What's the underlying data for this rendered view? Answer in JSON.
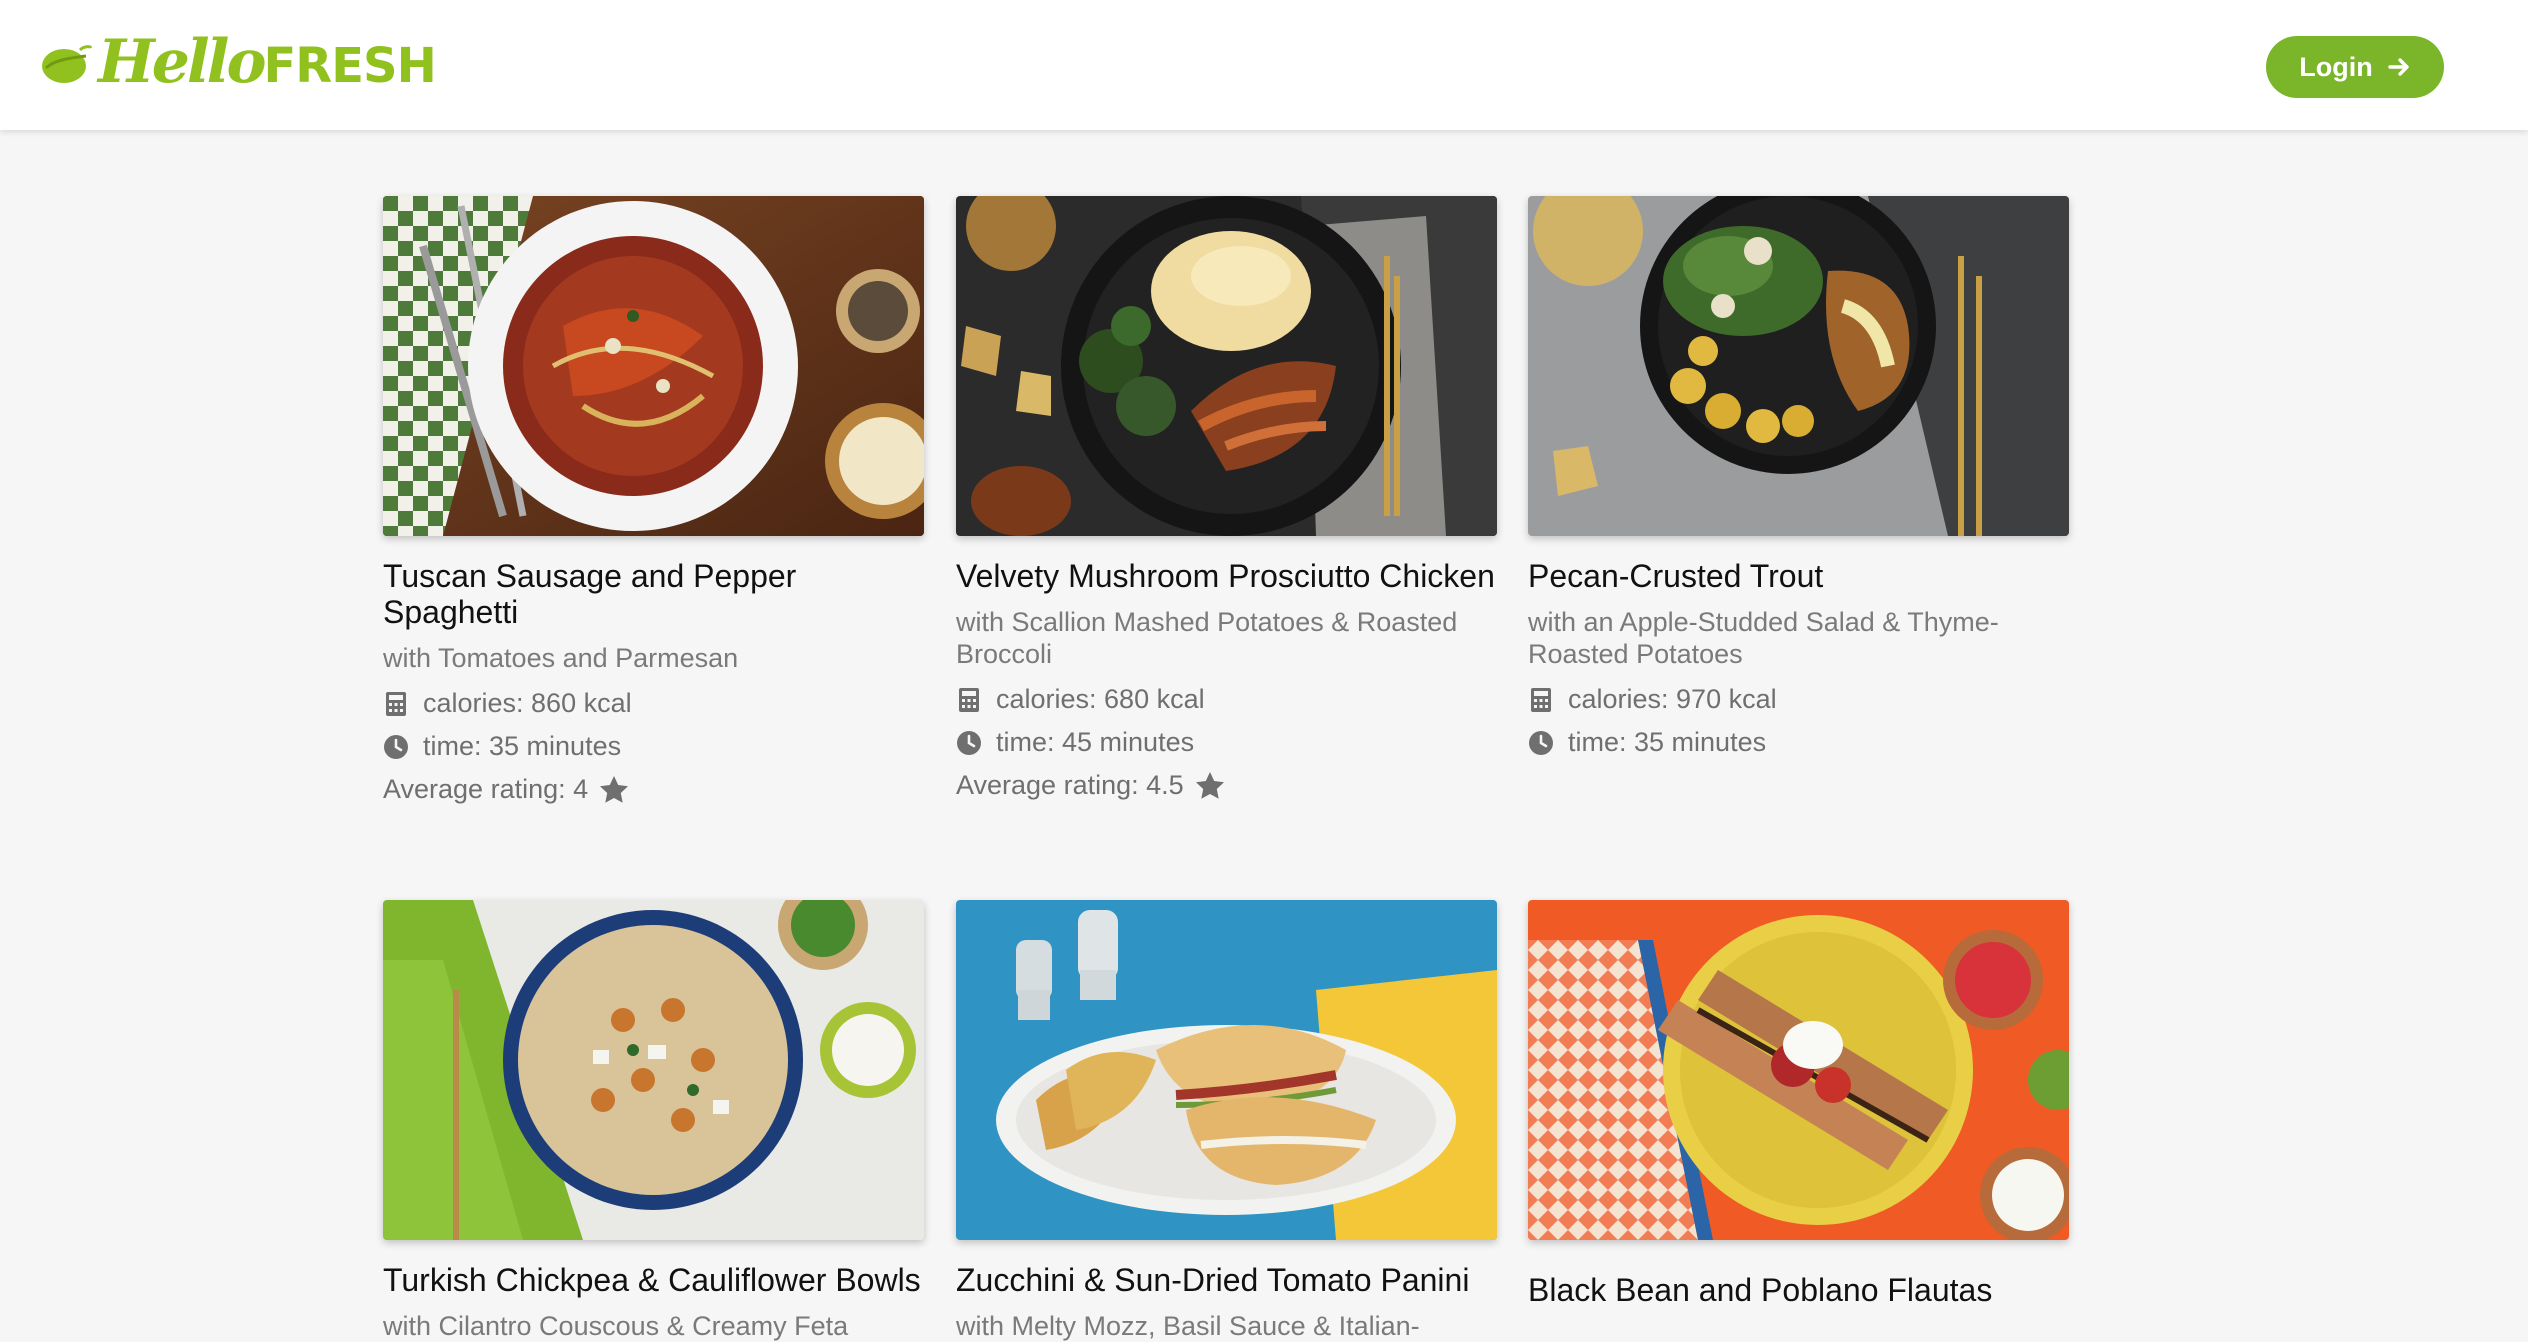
{
  "brand": {
    "logo_hello": "Hello",
    "logo_fresh": "FRESH",
    "accent_color": "#91c11e",
    "button_color": "#7bb62a"
  },
  "header": {
    "login_label": "Login",
    "login_icon": "arrow-right-icon"
  },
  "recipes": [
    {
      "title": "Tuscan Sausage and Pepper Spaghetti",
      "subtitle": "with Tomatoes and Parmesan",
      "calories": "calories: 860 kcal",
      "time": "time: 35 minutes",
      "rating": "Average rating: 4",
      "image": "spaghetti-bowl"
    },
    {
      "title": "Velvety Mushroom Prosciutto Chicken",
      "subtitle": "with Scallion Mashed Potatoes & Roasted Broccoli",
      "calories": "calories: 680 kcal",
      "time": "time: 45 minutes",
      "rating": "Average rating: 4.5",
      "image": "chicken-plate"
    },
    {
      "title": "Pecan-Crusted Trout",
      "subtitle": "with an Apple-Studded Salad & Thyme-Roasted Potatoes",
      "calories": "calories: 970 kcal",
      "time": "time: 35 minutes",
      "rating": "",
      "image": "trout-plate"
    },
    {
      "title": "Turkish Chickpea & Cauliflower Bowls",
      "subtitle": "with Cilantro Couscous & Creamy Feta",
      "image": "chickpea-bowl"
    },
    {
      "title": "Zucchini & Sun-Dried Tomato Panini",
      "subtitle": "with Melty Mozz, Basil Sauce & Italian-",
      "image": "panini-plate"
    },
    {
      "title": "Black Bean and Poblano Flautas",
      "image": "flautas-plate"
    }
  ],
  "icons": {
    "calories": "calculator-icon",
    "time": "clock-icon",
    "rating": "star-icon"
  }
}
